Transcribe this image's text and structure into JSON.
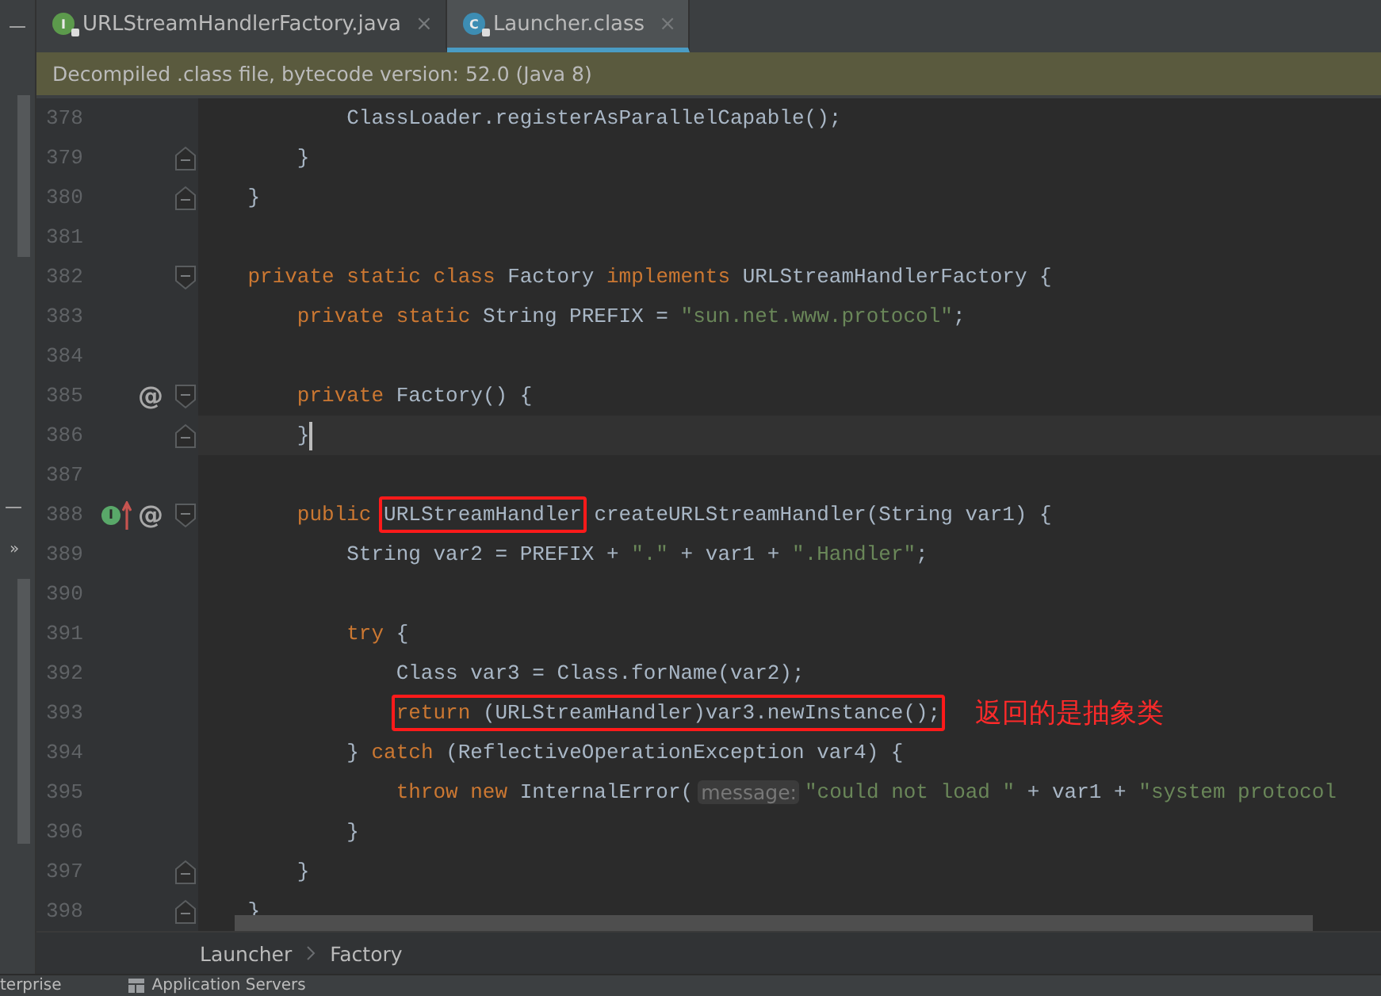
{
  "tabs": [
    {
      "label": "URLStreamHandlerFactory.java",
      "badge": "I",
      "color": "#5c9a4c",
      "close": "×",
      "selected": false
    },
    {
      "label": "Launcher.class",
      "badge": "C",
      "color": "#3d8db3",
      "close": "×",
      "selected": true
    }
  ],
  "banner": "Decompiled .class file, bytecode version: 52.0 (Java 8)",
  "side_strip": {
    "top_button": "—",
    "mid_button": "—",
    "expand": "»"
  },
  "editor": {
    "lines": [
      {
        "number": "378",
        "tokens": [
          {
            "kind": "plain",
            "text": "            ClassLoader.registerAsParallelCapable();"
          }
        ]
      },
      {
        "number": "379",
        "fold": {
          "kind": "end"
        },
        "tokens": [
          {
            "kind": "plain",
            "text": "        }"
          }
        ]
      },
      {
        "number": "380",
        "fold": {
          "kind": "end"
        },
        "tokens": [
          {
            "kind": "plain",
            "text": "    }"
          }
        ]
      },
      {
        "number": "381"
      },
      {
        "number": "382",
        "fold": {
          "kind": "start"
        },
        "tokens": [
          {
            "kind": "keyword",
            "text": "    private static class "
          },
          {
            "kind": "plain",
            "text": "Factory "
          },
          {
            "kind": "keyword",
            "text": "implements "
          },
          {
            "kind": "plain",
            "text": "URLStreamHandlerFactory {"
          }
        ]
      },
      {
        "number": "383",
        "tokens": [
          {
            "kind": "keyword",
            "text": "        private static "
          },
          {
            "kind": "plain",
            "text": "String PREFIX = "
          },
          {
            "kind": "string",
            "text": "\"sun.net.www.protocol\""
          },
          {
            "kind": "plain",
            "text": ";"
          }
        ]
      },
      {
        "number": "384"
      },
      {
        "number": "385",
        "fold": {
          "kind": "start"
        },
        "markers": [
          {
            "kind": "override",
            "symbol": "@"
          }
        ],
        "tokens": [
          {
            "kind": "keyword",
            "text": "        private "
          },
          {
            "kind": "plain",
            "text": "Factory() {"
          }
        ]
      },
      {
        "number": "386",
        "fold": {
          "kind": "end"
        },
        "current": true,
        "tokens": [
          {
            "kind": "plain",
            "text": "        }"
          }
        ]
      },
      {
        "number": "387"
      },
      {
        "number": "388",
        "fold": {
          "kind": "start"
        },
        "markers": [
          {
            "kind": "implements",
            "symbol": "I"
          },
          {
            "kind": "override",
            "symbol": "@"
          }
        ],
        "tokens": [
          {
            "kind": "keyword",
            "text": "        public "
          },
          {
            "kind": "box",
            "tokens": [
              {
                "kind": "plain",
                "text": "URLStreamHandler"
              }
            ]
          },
          {
            "kind": "plain",
            "text": " createURLStreamHandler(String var1) {"
          }
        ]
      },
      {
        "number": "389",
        "tokens": [
          {
            "kind": "plain",
            "text": "            String var2 = PREFIX + "
          },
          {
            "kind": "string",
            "text": "\".\""
          },
          {
            "kind": "plain",
            "text": " + var1 + "
          },
          {
            "kind": "string",
            "text": "\".Handler\""
          },
          {
            "kind": "plain",
            "text": ";"
          }
        ]
      },
      {
        "number": "390"
      },
      {
        "number": "391",
        "tokens": [
          {
            "kind": "keyword",
            "text": "            try"
          },
          {
            "kind": "plain",
            "text": " {"
          }
        ]
      },
      {
        "number": "392",
        "tokens": [
          {
            "kind": "plain",
            "text": "                Class var3 = Class.forName(var2);"
          }
        ]
      },
      {
        "number": "393",
        "note": "返回的是抽象类",
        "tokens": [
          {
            "kind": "box",
            "tokens": [
              {
                "kind": "keyword",
                "text": "                return"
              },
              {
                "kind": "plain",
                "text": " (URLStreamHandler)var3.newInstance();"
              }
            ]
          }
        ]
      },
      {
        "number": "394",
        "tokens": [
          {
            "kind": "plain",
            "text": "            } "
          },
          {
            "kind": "keyword",
            "text": "catch"
          },
          {
            "kind": "plain",
            "text": " (ReflectiveOperationException var4) {"
          }
        ]
      },
      {
        "number": "395",
        "tokens": [
          {
            "kind": "keyword",
            "text": "                throw new "
          },
          {
            "kind": "plain",
            "text": "InternalError("
          },
          {
            "kind": "hint",
            "text": "message:"
          },
          {
            "kind": "string",
            "text": "\"could not load \""
          },
          {
            "kind": "plain",
            "text": " + var1 + "
          },
          {
            "kind": "string",
            "text": "\"system protocol"
          }
        ]
      },
      {
        "number": "396",
        "tokens": [
          {
            "kind": "plain",
            "text": "            }"
          }
        ]
      },
      {
        "number": "397",
        "fold": {
          "kind": "end"
        },
        "tokens": [
          {
            "kind": "plain",
            "text": "        }"
          }
        ]
      },
      {
        "number": "398",
        "fold": {
          "kind": "end"
        },
        "tokens": [
          {
            "kind": "plain",
            "text": "    }"
          }
        ]
      }
    ]
  },
  "breadcrumbs": [
    "Launcher",
    "Factory"
  ],
  "bottom_bar": [
    {
      "kind": "text",
      "label": "terprise"
    },
    {
      "kind": "servers",
      "label": "Application Servers"
    }
  ]
}
